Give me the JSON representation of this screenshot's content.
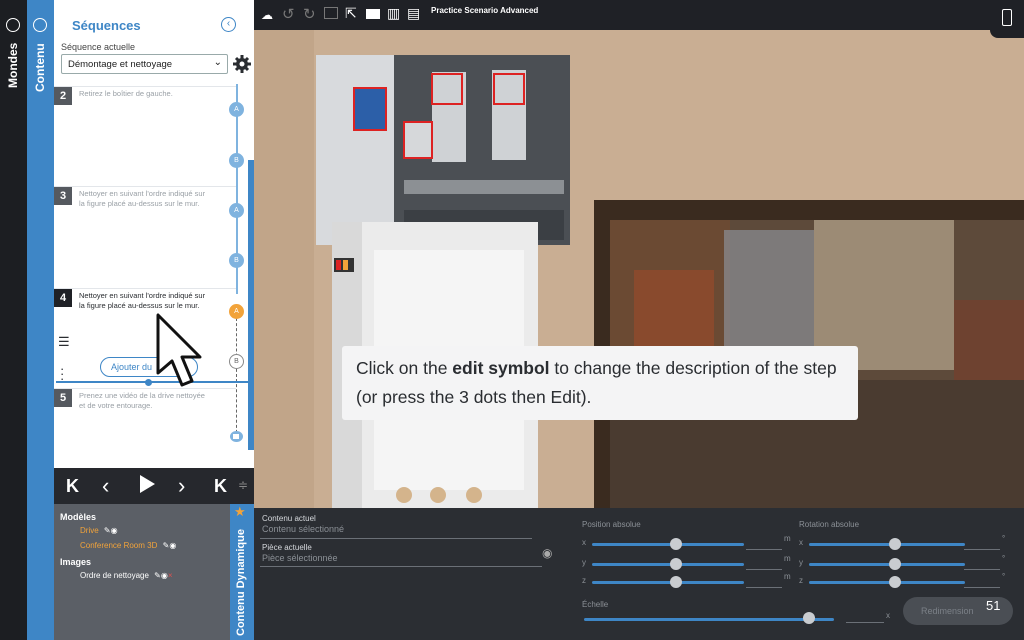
{
  "rails": {
    "mondes_label": "Mondes",
    "contenu_label": "Contenu"
  },
  "sequences": {
    "title": "Séquences",
    "current_label": "Séquence actuelle",
    "current_value": "Démontage et nettoyage",
    "add_button": "Ajouter du",
    "steps": [
      {
        "num": "2",
        "text": "Retirez le boîtier de gauche."
      },
      {
        "num": "3",
        "text": "Nettoyer en suivant l'ordre indiqué sur la figure placé au-dessus sur le mur."
      },
      {
        "num": "4",
        "text": "Nettoyer en suivant l'ordre indiqué sur la figure placé au-dessus sur le mur."
      },
      {
        "num": "5",
        "text": "Prenez une vidéo de la drive nettoyée et de votre entourage."
      }
    ],
    "nodes": [
      "A",
      "B",
      "A",
      "B",
      "A",
      "B"
    ]
  },
  "models_panel": {
    "models_heading": "Modèles",
    "models": [
      "Drive",
      "Conference Room 3D"
    ],
    "images_heading": "Images",
    "images": [
      "Ordre de nettoyage"
    ],
    "dynamic_label": "Contenu Dynamique"
  },
  "toolbar": {
    "title": "Practice Scenario Advanced"
  },
  "bottom": {
    "current_content_label": "Contenu actuel",
    "current_content_value": "Contenu sélectionné",
    "current_piece_label": "Pièce actuelle",
    "current_piece_value": "Pièce sélectionnée",
    "position_label": "Position absolue",
    "rotation_label": "Rotation absolue",
    "scale_label": "Échelle",
    "axes": [
      "x",
      "y",
      "z"
    ],
    "unit_m": "m",
    "unit_deg": "°",
    "unit_x": "x",
    "resize_button": "Redimension",
    "page_number": "51",
    "position_levels": [
      0.55,
      0.55,
      0.55
    ],
    "rotation_levels": [
      0.55,
      0.55,
      0.55
    ],
    "scale_level": 0.9
  },
  "tooltip": {
    "before": "Click on the ",
    "bold": "edit symbol",
    "after": " to change the description of the step (or press the 3 dots then Edit)."
  },
  "colors": {
    "accent": "#3e86c6",
    "highlight": "#f2a33a",
    "dark": "#1f2126"
  }
}
